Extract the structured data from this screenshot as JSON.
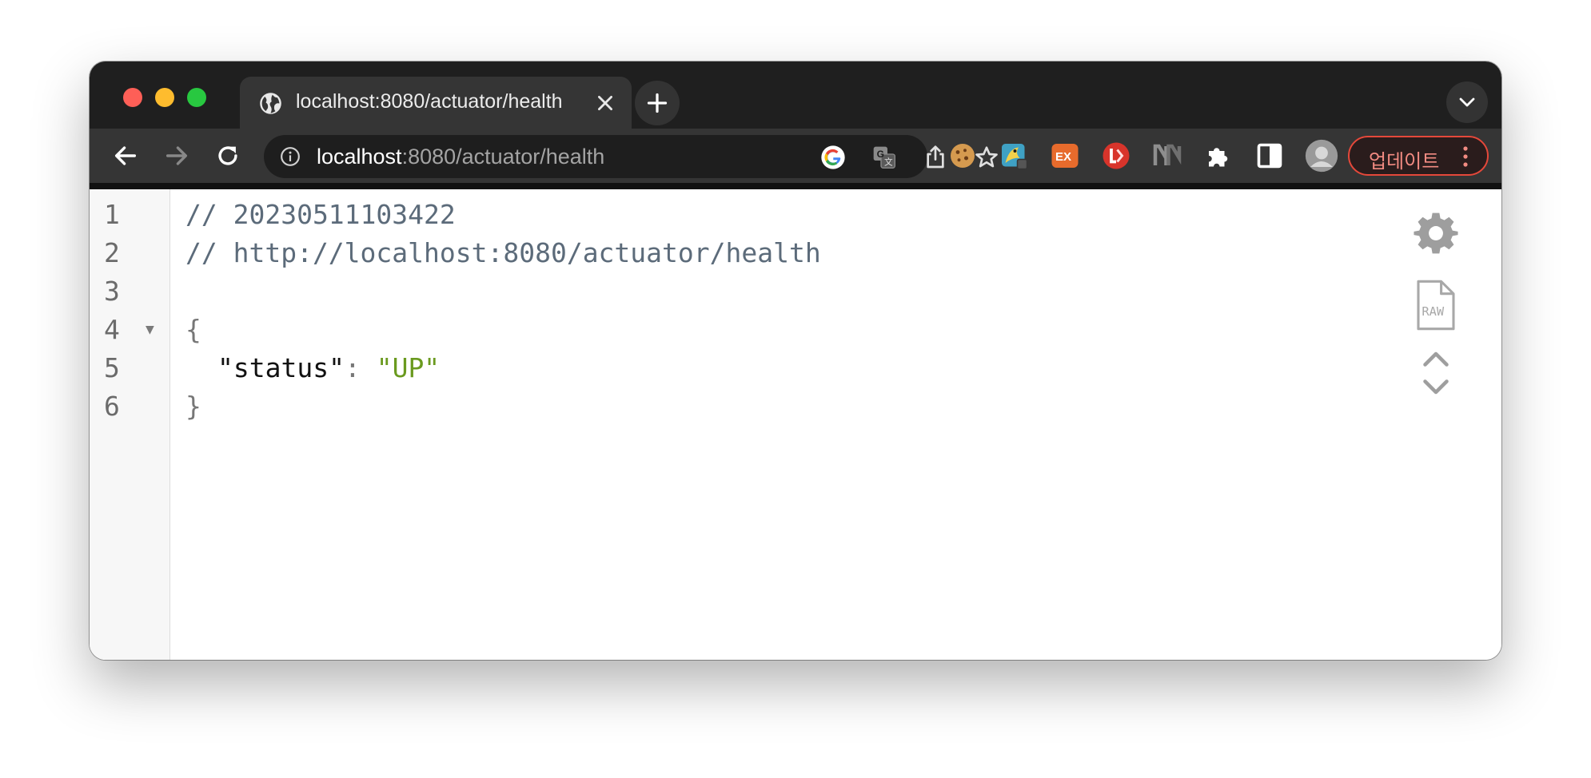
{
  "browser": {
    "tab": {
      "title": "localhost:8080/actuator/health",
      "icon": "globe-icon"
    },
    "omnibox": {
      "host": "localhost",
      "path": ":8080/actuator/health"
    },
    "update_button_label": "업데이트",
    "colors": {
      "update_border": "#e5483a",
      "update_text": "#f28b82",
      "chrome_dark": "#1f1f1f"
    }
  },
  "json_viewer": {
    "line_numbers": [
      "1",
      "2",
      "3",
      "4",
      "5",
      "6"
    ],
    "comment_timestamp": "// 20230511103422",
    "comment_url": "// http://localhost:8080/actuator/health",
    "open_brace": "{",
    "close_brace": "}",
    "key": "\"status\"",
    "colon": ": ",
    "value": "\"UP\"",
    "fold_marker": "▼",
    "colors": {
      "comment": "#5c6b7a",
      "string_value": "#6a9a1f",
      "key": "#111111"
    }
  }
}
